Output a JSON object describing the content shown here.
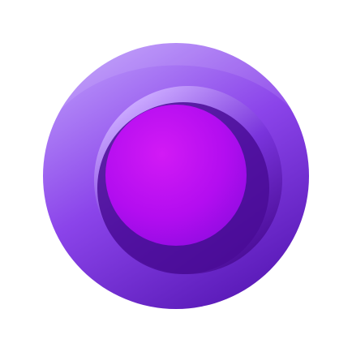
{
  "logo": {
    "icon": "concentric-circle-logo",
    "colors": {
      "background": "#ffffff",
      "outer_light": "#b48cf8",
      "outer_mid": "#8b44ea",
      "outer_dark": "#5a1ab8",
      "ring_shadow": "#4a0c96",
      "ring_highlight": "#caa8ff",
      "inner_light": "#d21af5",
      "inner_mid": "#b30df0",
      "inner_dark": "#8e0ce0"
    }
  }
}
